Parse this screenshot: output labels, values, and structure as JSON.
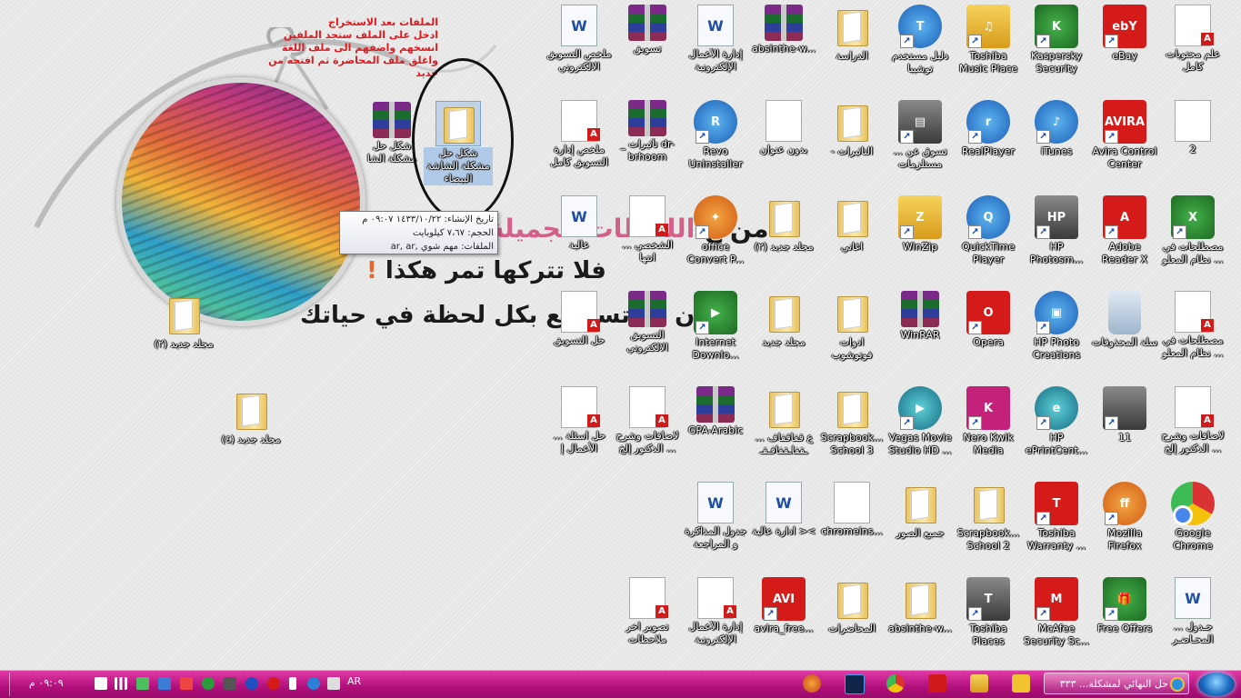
{
  "annotation": {
    "lines": [
      "الملفات بعد الاستخراج",
      "ادخل على الملف ستجد الملفين",
      "انسخهم واضفهم الى ملف اللغة",
      "واغلق ملف المحاضرة ثم افتحه من",
      "جديد"
    ]
  },
  "wallpaper": {
    "line1_pink": "اللحظات الجميلة",
    "line1_black": "من ع",
    "line2": "فلا تتركها تمر هكذا",
    "line2_excl": "!",
    "line3": "دون أن تستمتع بكل لحظة في حياتك"
  },
  "tooltip": {
    "date": "تاريخ الإنشاء: ١٤٣٣/١٠/٢٢ ٠٩:٠٧ م",
    "size": "الحجم: ٧،٦٧ كيلوبايت",
    "files": "الملفات: مهم شوي ,ar, ar"
  },
  "left_icons": [
    {
      "label": "شكل حل مشكلة الشا",
      "type": "rar"
    },
    {
      "label": "شكل حل مشكلة الشاشة البيضاء",
      "type": "folder",
      "selected": true
    },
    {
      "label": "مجلد جديد (٢)",
      "type": "folder"
    },
    {
      "label": "مجلد جديد (٤)",
      "type": "folder"
    }
  ],
  "grid_icons": [
    {
      "label": "علم محتويات كامل",
      "type": "pdf"
    },
    {
      "label": "eBay",
      "type": "red",
      "text": "ebY"
    },
    {
      "label": "Kaspersky Security Scan",
      "type": "green",
      "text": "K"
    },
    {
      "label": "Toshiba Music Place",
      "type": "yellow",
      "text": "♫"
    },
    {
      "label": "دليل مستخدم توشيبا",
      "type": "blue",
      "text": "T"
    },
    {
      "label": "الدراسة",
      "type": "folder"
    },
    {
      "label": "absinthe-w...",
      "type": "rar"
    },
    {
      "label": "إدارة الأعمال الإلكترونية",
      "type": "word"
    },
    {
      "label": "تسويق",
      "type": "rar"
    },
    {
      "label": "ملخص التسويق الالكتروني",
      "type": "word"
    },
    {
      "label": "2",
      "type": "doc"
    },
    {
      "label": "Avira Control Center",
      "type": "red",
      "text": "AVIRA"
    },
    {
      "label": "iTunes",
      "type": "blue",
      "text": "♪"
    },
    {
      "label": "RealPlayer",
      "type": "blue",
      "text": "r"
    },
    {
      "label": "تسوق عن ... مستلزمات",
      "type": "gray",
      "text": "▤"
    },
    {
      "label": "- التاثيرات",
      "type": "folder"
    },
    {
      "label": "بدون عنوان",
      "type": "doc"
    },
    {
      "label": "Revo Uninstaller",
      "type": "blue",
      "text": "R"
    },
    {
      "label": "_ تأثيرات dr-brhoom",
      "type": "rar"
    },
    {
      "label": "ملخص إدارة التسويق كامل",
      "type": "pdf"
    },
    {
      "label": "مصطلحات في ... نظام المعلو",
      "type": "green",
      "text": "X"
    },
    {
      "label": "Adobe Reader X",
      "type": "red",
      "text": "A"
    },
    {
      "label": "HP Photosm...",
      "type": "gray",
      "text": "HP"
    },
    {
      "label": "QuickTime Player",
      "type": "blue",
      "text": "Q"
    },
    {
      "label": "WinZip",
      "type": "yellow",
      "text": "Z"
    },
    {
      "label": "اغاني",
      "type": "folder"
    },
    {
      "label": "مجلد جديد (٢)",
      "type": "folder"
    },
    {
      "label": "office Convert P...",
      "type": "orange",
      "text": "✦"
    },
    {
      "label": "... الشخصي انتها",
      "type": "pdf"
    },
    {
      "label": "عالية",
      "type": "word"
    },
    {
      "label": "مصطلحات في ... نظام المعلو",
      "type": "pdf"
    },
    {
      "label": "سلة المحذوفات",
      "type": "trash",
      "text": ""
    },
    {
      "label": "HP Photo Creations",
      "type": "blue",
      "text": "▣"
    },
    {
      "label": "Opera",
      "type": "red",
      "text": "O"
    },
    {
      "label": "WinRAR",
      "type": "rar"
    },
    {
      "label": "ادوات فوتوشوب",
      "type": "folder"
    },
    {
      "label": "مجلد جديد",
      "type": "folder"
    },
    {
      "label": "Internet Downlo...",
      "type": "green",
      "text": "▶"
    },
    {
      "label": "التسويق الالكتروني",
      "type": "rar"
    },
    {
      "label": "حل التسويق",
      "type": "pdf"
    },
    {
      "label": "لاضافات وشرح ... الدكتور إلخ",
      "type": "pdf"
    },
    {
      "label": "11",
      "type": "gray",
      "text": ""
    },
    {
      "label": "HP ePrintCent...",
      "type": "teal",
      "text": "e"
    },
    {
      "label": "Nero Kwik Media",
      "type": "purple",
      "text": "K"
    },
    {
      "label": "Vegas Movie Studio HD ...",
      "type": "teal",
      "text": "▶"
    },
    {
      "label": "Scrapbook... School 3",
      "type": "folder"
    },
    {
      "label": "ع قفاقفاف ... ـقفاـقفافـقـ",
      "type": "folder"
    },
    {
      "label": "GPA-Arabic",
      "type": "rar"
    },
    {
      "label": "لاضافات وشرح ... الدكتور إلخ",
      "type": "pdf"
    },
    {
      "label": "حل اسئلة ... الأعمال إ",
      "type": "pdf"
    },
    {
      "label": "Google Chrome",
      "type": "chrome",
      "text": ""
    },
    {
      "label": "Mozilla Firefox",
      "type": "orange",
      "text": "ff"
    },
    {
      "label": "Toshiba Warranty ...",
      "type": "red",
      "text": "T"
    },
    {
      "label": "Scrapbook... School 2",
      "type": "folder"
    },
    {
      "label": "جميع الصور",
      "type": "folder"
    },
    {
      "label": "chromeins...",
      "type": "doc"
    },
    {
      "label": "ادارة عالية ><",
      "type": "word"
    },
    {
      "label": "جدول المذاكرة و المراجعة عشان",
      "type": "word"
    },
    {
      "label": "جـدول ... المحـاضـر",
      "type": "word"
    },
    {
      "label": "Free Offers",
      "type": "green",
      "text": "🎁"
    },
    {
      "label": "McAfee Security Sc...",
      "type": "red",
      "text": "M"
    },
    {
      "label": "Toshiba Places",
      "type": "gray",
      "text": "T"
    },
    {
      "label": "absinthe-w...",
      "type": "folder"
    },
    {
      "label": "المحاضرات",
      "type": "folder"
    },
    {
      "label": "avira_free...",
      "type": "red",
      "text": "AVI"
    },
    {
      "label": "إدارة الأعمال الإلكترونية",
      "type": "pdf"
    },
    {
      "label": "تصوير اخر ملاحظات تسويق",
      "type": "pdf"
    }
  ],
  "taskbar": {
    "active_task": "حل النهائي لمشكلة... ٣٣٣",
    "clock": "٠٩:٠٩ م",
    "language": "AR",
    "pinned": [
      "firefox-icon",
      "photoshop-icon",
      "chrome-icon",
      "acrobat-icon",
      "explorer-icon",
      "media-icon"
    ],
    "colors": {
      "bar": "#c0168a",
      "start_orb": "#1d6fc4"
    }
  }
}
